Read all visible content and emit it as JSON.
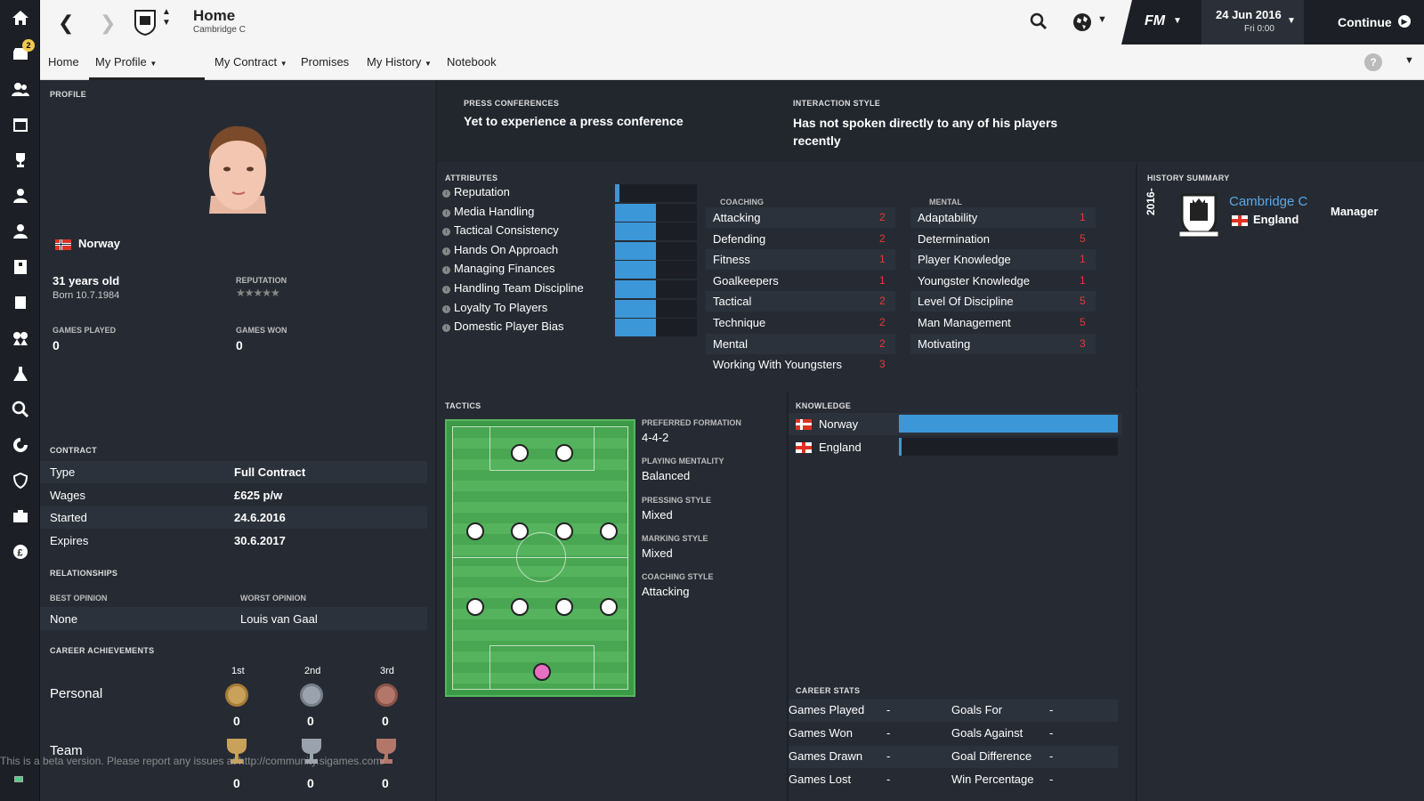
{
  "sidebar": {
    "icons": [
      "home-icon",
      "inbox-icon",
      "squad-icon",
      "schedule-icon",
      "trophy-icon",
      "u21-icon",
      "u18-icon",
      "staff-icon",
      "reports-icon",
      "scouting-icon",
      "training-icon",
      "search-icon",
      "transfers-icon",
      "club-icon",
      "finance-icon",
      "money-icon"
    ],
    "inbox_count": "2"
  },
  "topbar": {
    "title": "Home",
    "subtitle": "Cambridge C",
    "date": "24 Jun 2016",
    "time": "Fri 0:00",
    "continue": "Continue",
    "fm": "FM"
  },
  "subnav": {
    "items": [
      "Home",
      "My Profile",
      "My Contract",
      "Promises",
      "My History",
      "Notebook"
    ],
    "help": "?"
  },
  "profile": {
    "section": "PROFILE",
    "nationality": "Norway",
    "age": "31 years old",
    "born": "Born 10.7.1984",
    "reputation_label": "REPUTATION",
    "games_played_label": "GAMES PLAYED",
    "games_played": "0",
    "games_won_label": "GAMES WON",
    "games_won": "0"
  },
  "contract": {
    "section": "CONTRACT",
    "rows": [
      {
        "k": "Type",
        "v": "Full Contract"
      },
      {
        "k": "Wages",
        "v": "£625 p/w"
      },
      {
        "k": "Started",
        "v": "24.6.2016"
      },
      {
        "k": "Expires",
        "v": "30.6.2017"
      }
    ]
  },
  "relationships": {
    "section": "RELATIONSHIPS",
    "best_label": "BEST OPINION",
    "best": "None",
    "worst_label": "WORST OPINION",
    "worst": "Louis van Gaal"
  },
  "achievements": {
    "section": "CAREER ACHIEVEMENTS",
    "cols": [
      "1st",
      "2nd",
      "3rd"
    ],
    "personal": "Personal",
    "team": "Team",
    "personal_counts": [
      "0",
      "0",
      "0"
    ],
    "team_counts": [
      "0",
      "0",
      "0"
    ]
  },
  "press": {
    "label": "PRESS CONFERENCES",
    "text": "Yet to experience a press conference"
  },
  "interaction": {
    "label": "INTERACTION STYLE",
    "text": "Has not spoken directly to any of his players recently"
  },
  "attributes": {
    "section": "ATTRIBUTES",
    "items": [
      {
        "name": "Reputation",
        "level": 0.05
      },
      {
        "name": "Media Handling",
        "level": 0.5
      },
      {
        "name": "Tactical Consistency",
        "level": 0.5
      },
      {
        "name": "Hands On Approach",
        "level": 0.5
      },
      {
        "name": "Managing Finances",
        "level": 0.5
      },
      {
        "name": "Handling Team Discipline",
        "level": 0.5
      },
      {
        "name": "Loyalty To Players",
        "level": 0.5
      },
      {
        "name": "Domestic Player Bias",
        "level": 0.5
      }
    ]
  },
  "coaching": {
    "section": "COACHING",
    "items": [
      {
        "k": "Attacking",
        "v": "2"
      },
      {
        "k": "Defending",
        "v": "2"
      },
      {
        "k": "Fitness",
        "v": "1"
      },
      {
        "k": "Goalkeepers",
        "v": "1"
      },
      {
        "k": "Tactical",
        "v": "2"
      },
      {
        "k": "Technique",
        "v": "2"
      },
      {
        "k": "Mental",
        "v": "2"
      },
      {
        "k": "Working With Youngsters",
        "v": "3"
      }
    ]
  },
  "mental": {
    "section": "MENTAL",
    "items": [
      {
        "k": "Adaptability",
        "v": "1"
      },
      {
        "k": "Determination",
        "v": "5"
      },
      {
        "k": "Player Knowledge",
        "v": "1"
      },
      {
        "k": "Youngster Knowledge",
        "v": "1"
      },
      {
        "k": "Level Of Discipline",
        "v": "5"
      },
      {
        "k": "Man Management",
        "v": "5"
      },
      {
        "k": "Motivating",
        "v": "3"
      }
    ]
  },
  "history": {
    "section": "HISTORY SUMMARY",
    "year": "2016-",
    "club": "Cambridge C",
    "country": "England",
    "role": "Manager"
  },
  "tactics": {
    "section": "TACTICS",
    "rows": [
      {
        "label": "PREFERRED FORMATION",
        "value": "4-4-2"
      },
      {
        "label": "PLAYING MENTALITY",
        "value": "Balanced"
      },
      {
        "label": "PRESSING STYLE",
        "value": "Mixed"
      },
      {
        "label": "MARKING STYLE",
        "value": "Mixed"
      },
      {
        "label": "COACHING STYLE",
        "value": "Attacking"
      }
    ]
  },
  "knowledge": {
    "section": "KNOWLEDGE",
    "items": [
      {
        "name": "Norway",
        "level": 1.0
      },
      {
        "name": "England",
        "level": 0.01
      }
    ]
  },
  "career_stats": {
    "section": "CAREER STATS",
    "left": [
      {
        "k": "Games Played",
        "v": "-"
      },
      {
        "k": "Games Won",
        "v": "-"
      },
      {
        "k": "Games Drawn",
        "v": "-"
      },
      {
        "k": "Games Lost",
        "v": "-"
      }
    ],
    "right": [
      {
        "k": "Goals For",
        "v": "-"
      },
      {
        "k": "Goals Against",
        "v": "-"
      },
      {
        "k": "Goal Difference",
        "v": "-"
      },
      {
        "k": "Win Percentage",
        "v": "-"
      }
    ]
  },
  "beta_notice": "This is a beta version. Please report any issues at http://community.sigames.com/",
  "colors": {
    "accent": "#3c97d9",
    "red": "#e23b3b",
    "pitch": "#4caf50",
    "gk": "#e86fc3"
  }
}
